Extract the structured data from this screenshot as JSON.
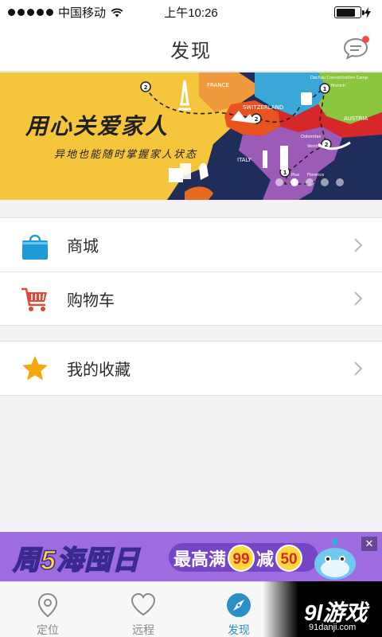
{
  "status_bar": {
    "carrier": "中国移动",
    "time": "上午10:26",
    "battery_level": 0.8
  },
  "header": {
    "title": "发现",
    "chat_icon": "chat-bubble-icon",
    "has_notification": true
  },
  "banner": {
    "title": "用心关爱家人",
    "subtitle": "异地也能随时掌握家人状态",
    "map_labels": {
      "france": "FRANCE",
      "switzerland": "SWITZERLAND",
      "austria": "AUSTRIA",
      "italy": "ITALY",
      "dachau": "Dachau Concentration Camp",
      "munich": "Munich",
      "venice": "Venice",
      "pisa": "Pisa",
      "florence": "Florence",
      "dolomites": "Dolomites"
    },
    "slide_count": 5,
    "active_slide": 2
  },
  "menu": {
    "group1": [
      {
        "label": "商城",
        "icon": "shopping-bag-icon"
      },
      {
        "label": "购物车",
        "icon": "shopping-cart-icon"
      }
    ],
    "group2": [
      {
        "label": "我的收藏",
        "icon": "star-icon"
      }
    ]
  },
  "ad": {
    "part1": "周",
    "num": "5",
    "part2": "海囤日",
    "text1": "最高满",
    "coin1": "99",
    "text2": "减",
    "coin2": "50",
    "close": "✕"
  },
  "tabbar": [
    {
      "label": "定位",
      "icon": "location-pin-icon"
    },
    {
      "label": "远程",
      "icon": "heart-icon"
    },
    {
      "label": "发现",
      "icon": "compass-icon",
      "active": true
    },
    {
      "label": "",
      "icon": "profile-icon"
    }
  ],
  "watermark": {
    "text": "9l游戏",
    "sub": "91danji.com"
  },
  "colors": {
    "accent": "#2a8fc9",
    "banner_yellow": "#f5c53b",
    "ad_purple": "#9d6de0",
    "badge_red": "#ef4b4b"
  }
}
